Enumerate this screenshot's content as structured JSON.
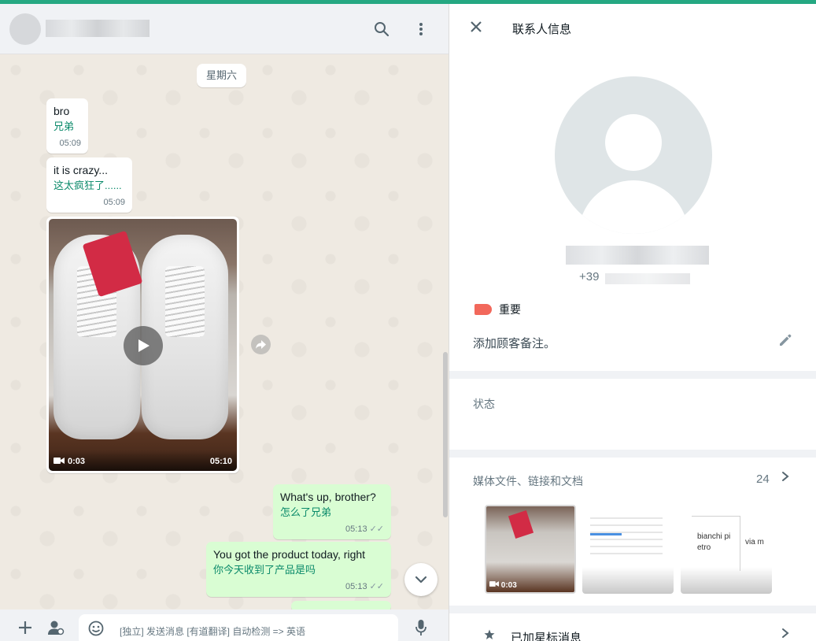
{
  "chat": {
    "date_chip": "星期六",
    "messages": [
      {
        "original": "bro",
        "translation": "兄弟",
        "time": "05:09"
      },
      {
        "original": "it is crazy...",
        "translation": "这太疯狂了......",
        "time": "05:09"
      },
      {
        "original": "What's up, brother?",
        "translation": "怎么了兄弟",
        "time": "05:13"
      },
      {
        "original": "You got the product today, right",
        "translation": "你今天收到了产品是吗",
        "time": "05:13"
      }
    ],
    "video": {
      "duration": "0:03",
      "time": "05:10"
    },
    "composer_placeholder": "[独立] 发送消息 [有道翻译] 自动检测 => 英语"
  },
  "icons": {
    "search": "search-icon",
    "menu": "more-vert-icon",
    "plus": "plus-icon",
    "contact": "contact-icon",
    "emoji": "emoji-icon",
    "mic": "mic-icon",
    "close": "close-icon",
    "edit": "pencil-icon",
    "star": "star-icon",
    "chevron": "chevron-right-icon",
    "forward": "forward-icon",
    "play": "play-icon",
    "video_cam": "video-camera-icon",
    "scroll_down": "chevron-down-icon"
  },
  "info": {
    "title": "联系人信息",
    "phone_prefix": "+39",
    "label": "重要",
    "note_placeholder": "添加顾客备注。",
    "status_label": "状态",
    "media_label": "媒体文件、链接和文档",
    "media_count": "24",
    "media_thumbs": [
      {
        "duration": "0:03"
      },
      {},
      {
        "text1": "bianchi pi etro",
        "text2": "via m"
      }
    ],
    "starred_label": "已加星标消息"
  },
  "colors": {
    "accent": "#25a882",
    "translation": "#0b8a6a",
    "outgoing_bubble": "#d9fdd3",
    "label_tag": "#f2685b"
  }
}
